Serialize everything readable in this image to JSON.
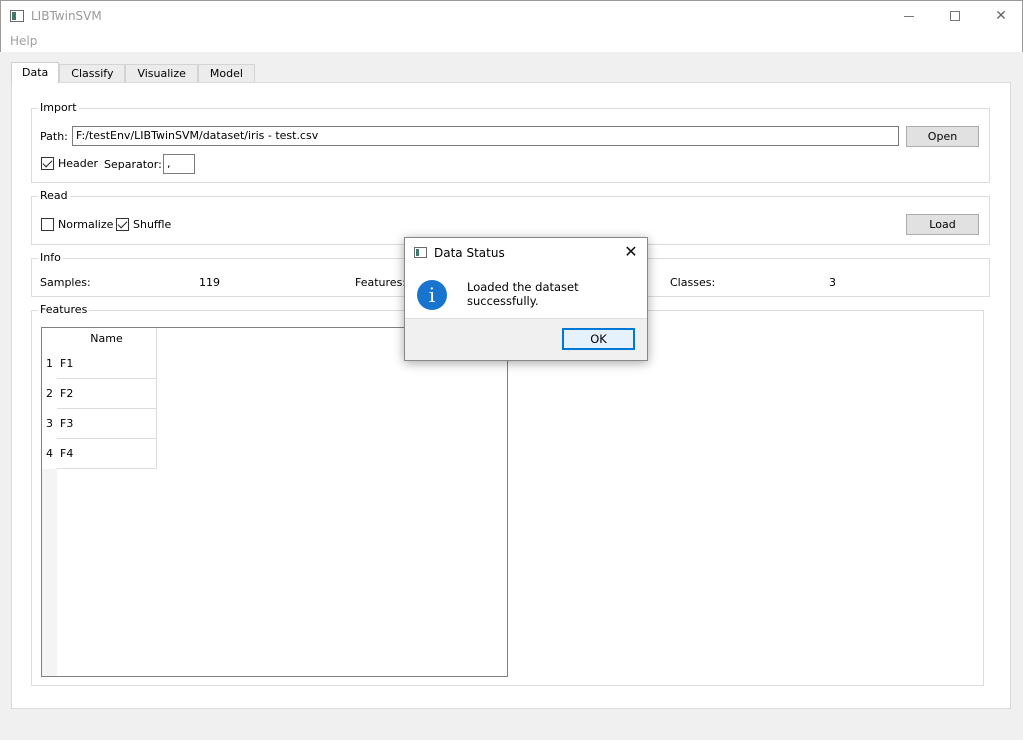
{
  "window": {
    "title": "LIBTwinSVM"
  },
  "menu": {
    "help": "Help"
  },
  "tabs": [
    "Data",
    "Classify",
    "Visualize",
    "Model"
  ],
  "import": {
    "title": "Import",
    "path_label": "Path:",
    "path_value": "F:/testEnv/LIBTwinSVM/dataset/iris - test.csv",
    "open_label": "Open",
    "header_label": "Header",
    "header_checked": true,
    "separator_label": "Separator:",
    "separator_value": ","
  },
  "read": {
    "title": "Read",
    "normalize_label": "Normalize",
    "normalize_checked": false,
    "shuffle_label": "Shuffle",
    "shuffle_checked": true,
    "load_label": "Load"
  },
  "info": {
    "title": "Info",
    "samples_label": "Samples:",
    "samples_value": "119",
    "features_label": "Features:",
    "classes_label": "Classes:",
    "classes_value": "3"
  },
  "features": {
    "title": "Features",
    "column_header": "Name",
    "rows": [
      {
        "num": "1",
        "name": "F1"
      },
      {
        "num": "2",
        "name": "F2"
      },
      {
        "num": "3",
        "name": "F3"
      },
      {
        "num": "4",
        "name": "F4"
      }
    ]
  },
  "dialog": {
    "title": "Data Status",
    "message": "Loaded the dataset successfully.",
    "ok_label": "OK",
    "icon": "info-icon"
  },
  "colors": {
    "accent": "#0078d7",
    "info_icon": "#1874cf"
  }
}
